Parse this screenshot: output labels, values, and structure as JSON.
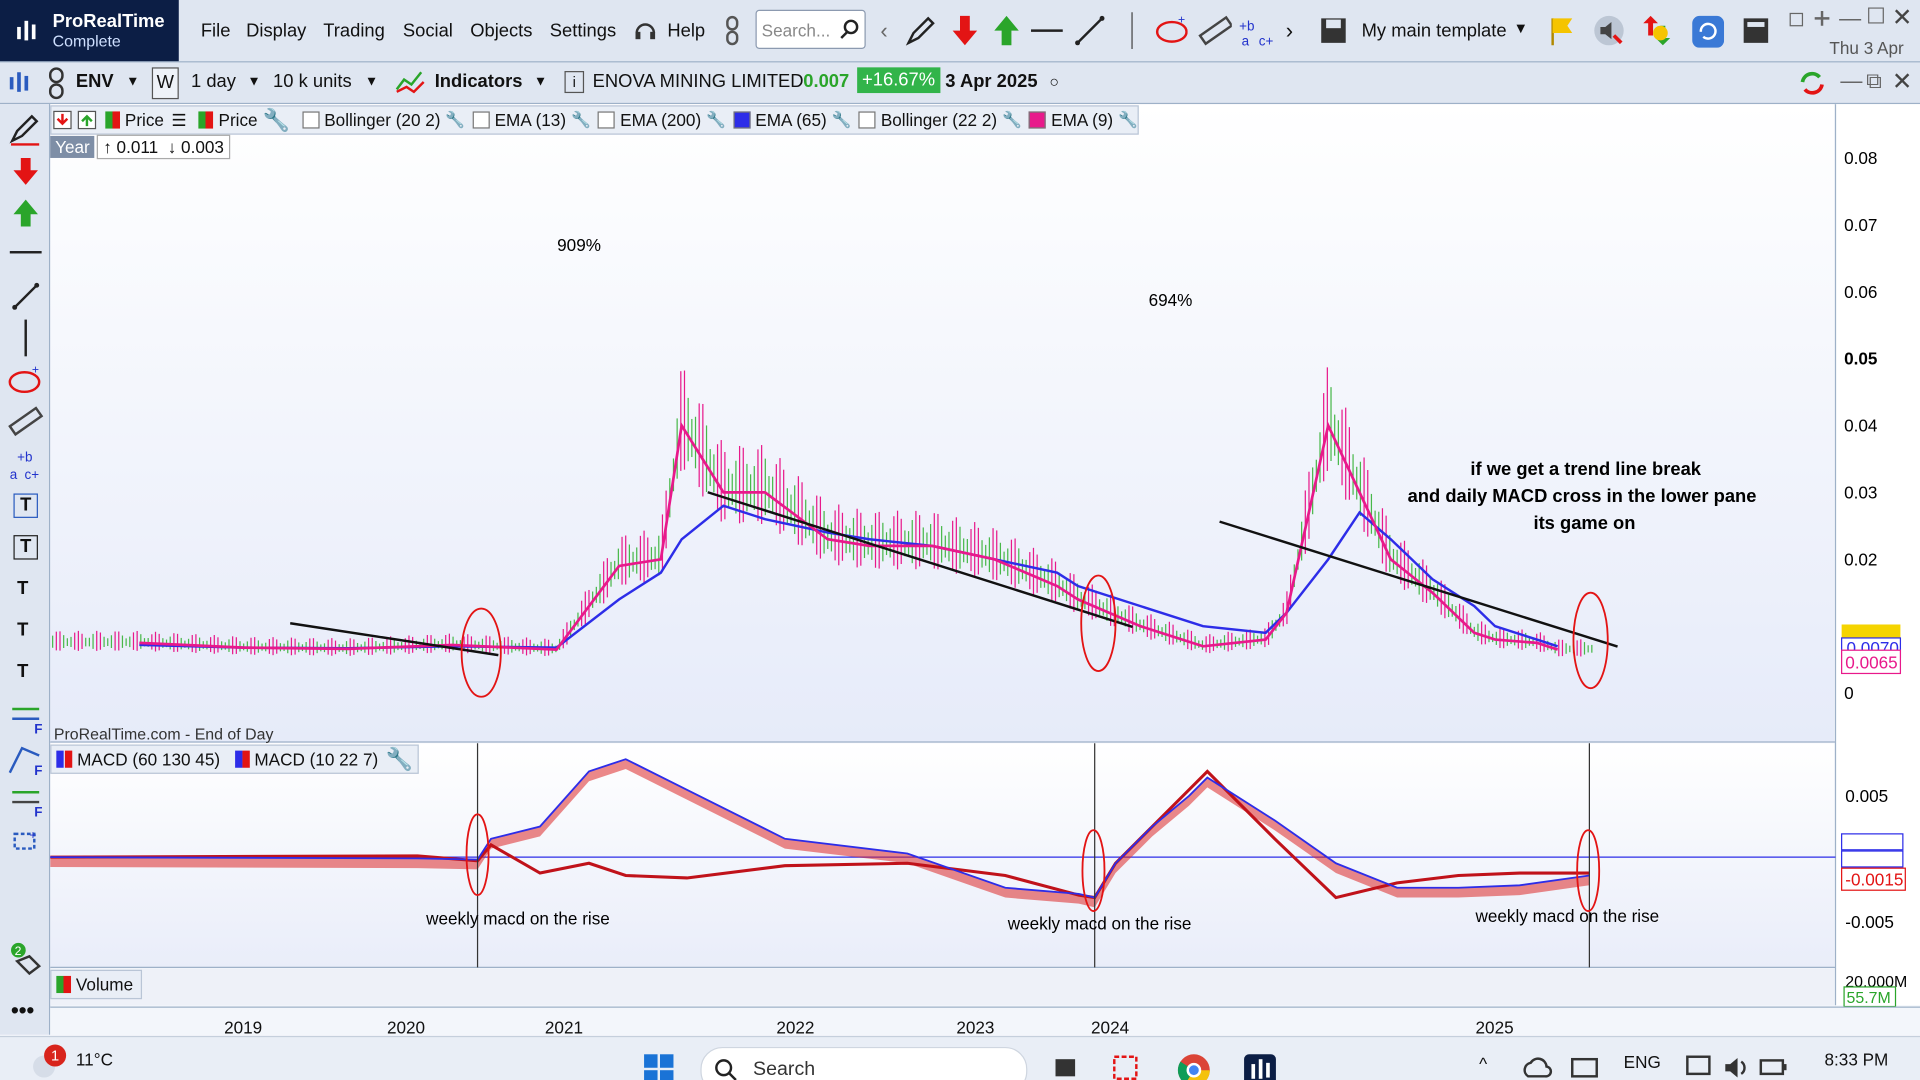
{
  "app": {
    "name": "ProRealTime",
    "edition": "Complete"
  },
  "menu": [
    "File",
    "Display",
    "Trading",
    "Social",
    "Objects",
    "Settings",
    "Help"
  ],
  "search": {
    "placeholder": "Search..."
  },
  "template": {
    "label": "My main template"
  },
  "clock_small": "Thu 3 Apr",
  "toolbar2": {
    "ticker": "ENV",
    "w_button": "W",
    "timeframe": "1 day",
    "units": "10 k units",
    "indicators": "Indicators",
    "company": "ENOVA MINING LIMITED",
    "price": "0.007",
    "change": "+16.67%",
    "date": "3 Apr 2025"
  },
  "legend": {
    "price1": "Price",
    "price2": "Price",
    "items": [
      "Bollinger (20 2)",
      "EMA (13)",
      "EMA (200)",
      "EMA (65)",
      "Bollinger (22 2)",
      "EMA (9)"
    ],
    "colors": [
      "",
      "",
      "",
      "#2d2de8",
      "",
      "#e8198b"
    ],
    "period": "Year",
    "up": "0.011",
    "down": "0.003"
  },
  "price_axis": {
    "ticks": [
      "0.08",
      "0.07",
      "0.06",
      "0.05",
      "0.04",
      "0.03",
      "0.02",
      "0"
    ],
    "current1": "0.0070",
    "current2": "0.0065"
  },
  "annotations": {
    "peak1": "909%",
    "peak2": "694%",
    "note": [
      "if we get a trend line break",
      "and daily MACD cross in the lower pane",
      "its game on"
    ],
    "macd1": "weekly macd on the rise",
    "macd2": "weekly macd on the rise",
    "macd3": "weekly macd on the rise",
    "source": "ProRealTime.com - End of Day"
  },
  "macd_legend": [
    "MACD (60 130 45)",
    "MACD (10 22 7)"
  ],
  "macd_axis": {
    "ticks": [
      "0.005",
      "-0.005"
    ],
    "v1": "-0.0015"
  },
  "volume": {
    "label": "Volume",
    "axis_top": "20.000M",
    "current": "55.7M"
  },
  "time_axis": [
    "2019",
    "2020",
    "2021",
    "2022",
    "2023",
    "2024",
    "2025"
  ],
  "taskbar": {
    "temp": "11°C",
    "badge": "1",
    "search": "Search",
    "lang": "ENG",
    "time": "8:33 PM"
  },
  "chart_data": {
    "type": "line",
    "x": [
      "2018.5",
      "2019",
      "2019.5",
      "2020",
      "2020.5",
      "2020.8",
      "2021",
      "2021.1",
      "2021.3",
      "2021.5",
      "2021.8",
      "2022",
      "2022.3",
      "2022.6",
      "2022.9",
      "2023",
      "2023.3",
      "2023.6",
      "2023.9",
      "2024",
      "2024.2",
      "2024.35",
      "2024.5",
      "2024.7",
      "2024.9",
      "2025",
      "2025.2",
      "2025.3"
    ],
    "series": [
      {
        "name": "EMA (9)",
        "values": [
          0.0075,
          0.0068,
          0.0066,
          0.0072,
          0.0065,
          0.019,
          0.02,
          0.04,
          0.03,
          0.03,
          0.023,
          0.022,
          0.022,
          0.02,
          0.016,
          0.014,
          0.01,
          0.007,
          0.008,
          0.012,
          0.04,
          0.03,
          0.02,
          0.015,
          0.009,
          0.008,
          0.0075,
          0.0065
        ]
      },
      {
        "name": "EMA (65)",
        "values": [
          0.0072,
          0.0068,
          0.0067,
          0.007,
          0.0068,
          0.014,
          0.018,
          0.023,
          0.028,
          0.026,
          0.024,
          0.023,
          0.022,
          0.02,
          0.018,
          0.016,
          0.013,
          0.01,
          0.009,
          0.012,
          0.02,
          0.027,
          0.023,
          0.017,
          0.013,
          0.01,
          0.008,
          0.007
        ]
      }
    ],
    "ylim": [
      0,
      0.08
    ]
  }
}
